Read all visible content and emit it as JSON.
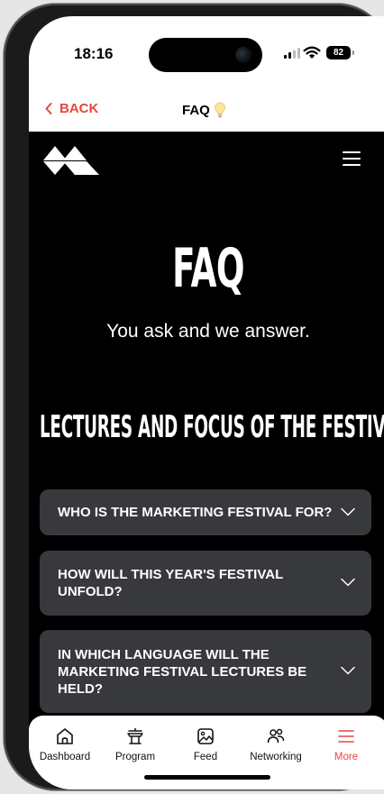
{
  "status_bar": {
    "time": "18:16",
    "battery": "82",
    "icons": [
      "signal-icon",
      "wifi-icon",
      "battery-icon"
    ]
  },
  "nav": {
    "back_label": "BACK",
    "title": "FAQ",
    "title_icon": "lightbulb-icon",
    "accent_color": "#e5473a"
  },
  "header": {
    "logo_icon": "triangles-logo",
    "menu_icon": "hamburger-menu-icon"
  },
  "hero": {
    "title": "FAQ",
    "subtitle": "You ask and we answer."
  },
  "section": {
    "title": "LECTURES AND FOCUS OF THE FESTIVAL"
  },
  "faq_items": [
    {
      "question": "WHO IS THE MARKETING FESTIVAL FOR?"
    },
    {
      "question": "HOW WILL THIS YEAR'S FESTIVAL UNFOLD?"
    },
    {
      "question": "IN WHICH LANGUAGE WILL THE MARKETING FESTIVAL LECTURES BE HELD?"
    }
  ],
  "tab_bar": {
    "tabs": [
      {
        "label": "Dashboard",
        "icon": "home-icon"
      },
      {
        "label": "Program",
        "icon": "podium-icon"
      },
      {
        "label": "Feed",
        "icon": "image-icon"
      },
      {
        "label": "Networking",
        "icon": "people-icon"
      },
      {
        "label": "More",
        "icon": "menu-icon"
      }
    ],
    "active": "More"
  }
}
